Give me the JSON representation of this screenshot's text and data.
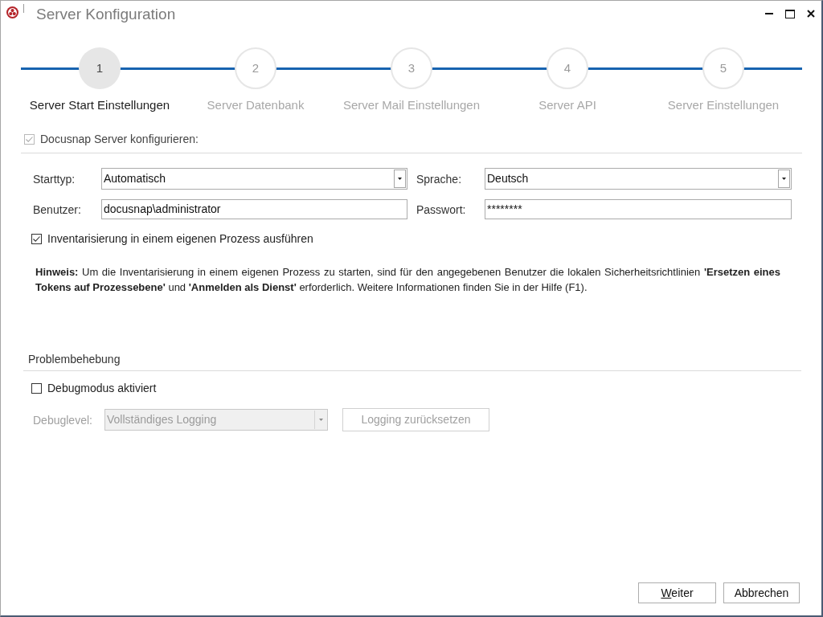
{
  "window": {
    "title": "Server Konfiguration"
  },
  "steps": [
    {
      "number": "1",
      "label": "Server Start Einstellungen",
      "selected": true
    },
    {
      "number": "2",
      "label": "Server Datenbank",
      "selected": false
    },
    {
      "number": "3",
      "label": "Server Mail Einstellungen",
      "selected": false
    },
    {
      "number": "4",
      "label": "Server API",
      "selected": false
    },
    {
      "number": "5",
      "label": "Server Einstellungen",
      "selected": false
    }
  ],
  "configure_server": {
    "label": "Docusnap Server konfigurieren:",
    "checked": true,
    "disabled": true
  },
  "fields": [
    {
      "kind": "dropdown",
      "label": "Starttyp:",
      "value": "Automatisch"
    },
    {
      "kind": "dropdown",
      "label": "Sprache:",
      "value": "Deutsch"
    },
    {
      "kind": "text",
      "label": "Benutzer:",
      "value": "docusnap\\administrator"
    },
    {
      "kind": "password",
      "label": "Passwort:",
      "value": "********"
    }
  ],
  "separate_process": {
    "label": "Inventarisierung in einem eigenen Prozess ausführen",
    "checked": true,
    "disabled": false
  },
  "note": "**Hinweis:** Um die Inventarisierung in einem eigenen Prozess zu starten, sind für den angegebenen Benutzer die lokalen Sicherheitsrichtlinien **'Ersetzen eines Tokens auf Prozessebene'** und **'Anmelden als Dienst'** erforderlich. Weitere Informationen finden Sie in der Hilfe (F1).",
  "troubleshooting": {
    "title": "Problembehebung",
    "debug_mode": {
      "label": "Debugmodus aktiviert",
      "checked": false,
      "disabled": false
    },
    "debug_level": {
      "label": "Debuglevel:",
      "value": "Vollständiges Logging",
      "disabled": true
    },
    "reset_button": {
      "label": "Logging zurücksetzen",
      "disabled": true
    }
  },
  "buttons": [
    {
      "label": "Weiter",
      "mnemonic": true
    },
    {
      "label": "Abbrechen",
      "mnemonic": false
    }
  ]
}
